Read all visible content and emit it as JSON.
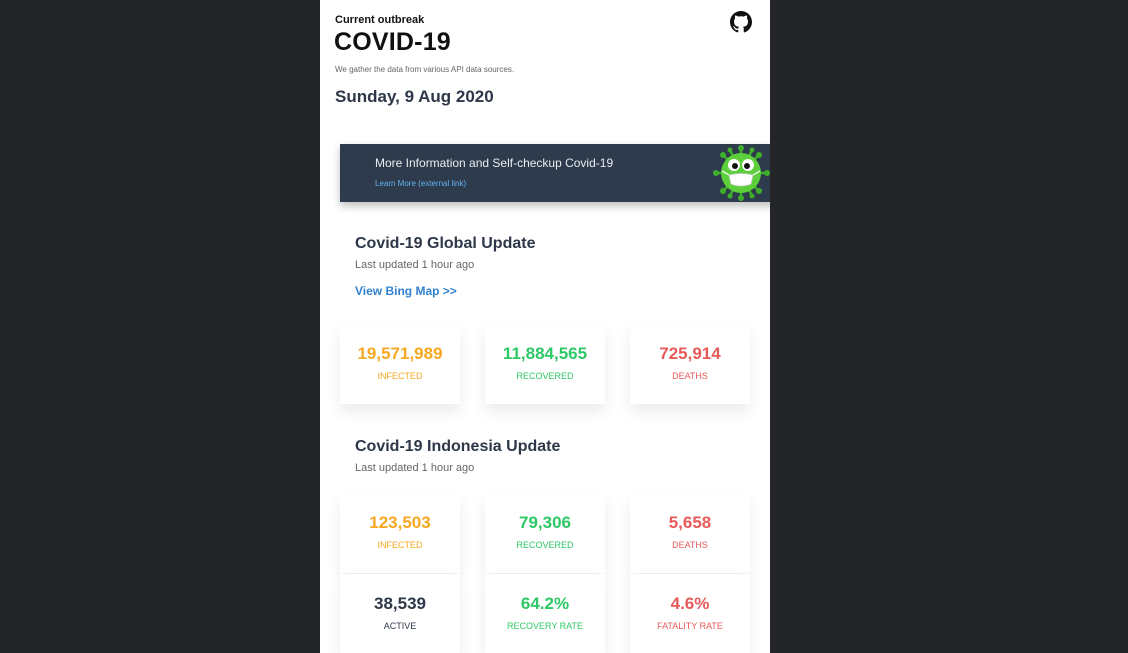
{
  "header": {
    "eyebrow": "Current outbreak",
    "title": "COVID-19",
    "subtitle": "We gather the data from various API data sources.",
    "date": "Sunday, 9 Aug 2020",
    "github_icon": "github-icon"
  },
  "banner": {
    "title": "More Information and Self-checkup Covid-19",
    "link": "Learn More (external link)",
    "mascot_icon": "virus-mascot-icon"
  },
  "global": {
    "title": "Covid-19 Global Update",
    "updated": "Last updated 1 hour ago",
    "map_link": "View Bing Map >>",
    "stats": [
      {
        "value": "19,571,989",
        "label": "INFECTED"
      },
      {
        "value": "11,884,565",
        "label": "RECOVERED"
      },
      {
        "value": "725,914",
        "label": "DEATHS"
      }
    ]
  },
  "indonesia": {
    "title": "Covid-19 Indonesia Update",
    "updated": "Last updated 1 hour ago",
    "stats": [
      {
        "value": "123,503",
        "label": "INFECTED"
      },
      {
        "value": "79,306",
        "label": "RECOVERED"
      },
      {
        "value": "5,658",
        "label": "DEATHS"
      },
      {
        "value": "38,539",
        "label": "ACTIVE"
      },
      {
        "value": "64.2%",
        "label": "RECOVERY RATE"
      },
      {
        "value": "4.6%",
        "label": "FATALITY RATE"
      }
    ]
  },
  "colors": {
    "background": "#232529",
    "infected": "#f6a821",
    "recovered": "#2ec866",
    "deaths": "#e85a5a",
    "link": "#3182ce",
    "banner": "#2d3b4c"
  }
}
